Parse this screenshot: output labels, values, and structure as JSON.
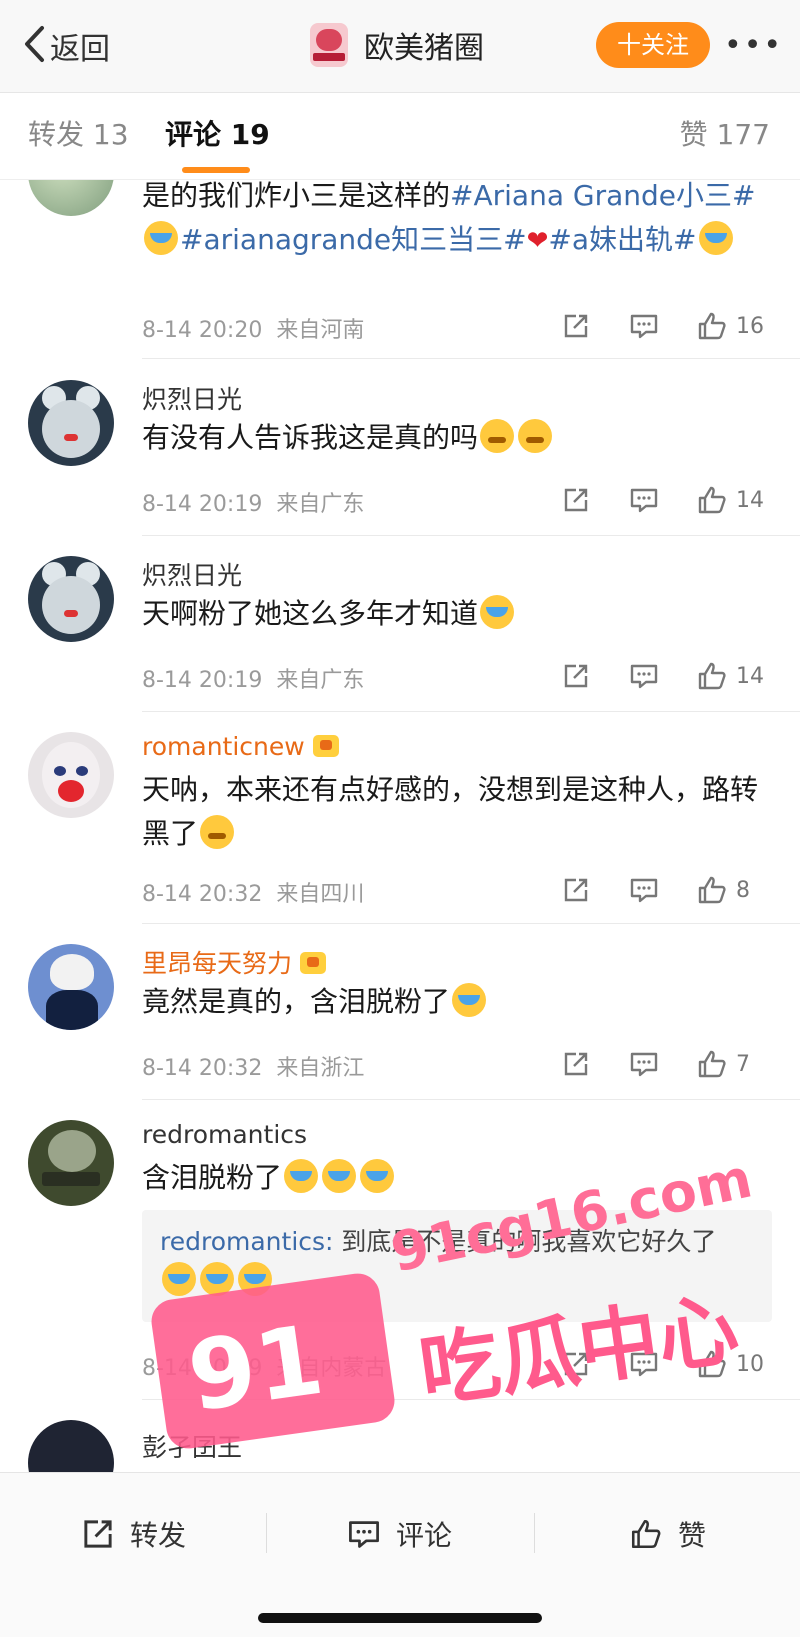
{
  "header": {
    "back_label": "返回",
    "title": "欧美猪圈",
    "follow_label": "十关注",
    "more_label": "•••"
  },
  "tabs": {
    "reposts": "转发 13",
    "comments": "评论 19",
    "likes": "赞 177"
  },
  "comments": [
    {
      "name": "",
      "text_parts": [
        "是的我们炸小三是这样的",
        "#Ariana Grande小三#",
        "#arianagrande知三当三#",
        "#a妹出轨#"
      ],
      "time": "8-14 20:20",
      "location": "来自河南",
      "likes": "16"
    },
    {
      "name": "炽烈日光",
      "text": "有没有人告诉我这是真的吗",
      "time": "8-14 20:19",
      "location": "来自广东",
      "likes": "14"
    },
    {
      "name": "炽烈日光",
      "text": "天啊粉了她这么多年才知道",
      "time": "8-14 20:19",
      "location": "来自广东",
      "likes": "14"
    },
    {
      "name": "romanticnew",
      "text": "天呐，本来还有点好感的，没想到是这种人，路转黑了",
      "time": "8-14 20:32",
      "location": "来自四川",
      "likes": "8"
    },
    {
      "name": "里昂每天努力",
      "text": "竟然是真的，含泪脱粉了",
      "time": "8-14 20:32",
      "location": "来自浙江",
      "likes": "7"
    },
    {
      "name": "redromantics",
      "text": "含泪脱粉了",
      "reply_name": "redromantics:",
      "reply_text": "到底是不是真的啊我喜欢它好久了",
      "time": "8-14 20:29",
      "location": "来自内蒙古",
      "likes": "10"
    },
    {
      "name": "彭孑囝王"
    }
  ],
  "watermark": {
    "url": "91cg16.com",
    "number": "91",
    "text": "吃瓜中心"
  },
  "bottom_bar": {
    "repost": "转发",
    "comment": "评论",
    "like": "赞"
  },
  "colors": {
    "accent_orange": "#ff8c1a",
    "hashtag_blue": "#3b6aa8",
    "vip_name": "#e86a17",
    "watermark_pink": "#ff5a8c"
  },
  "icons": {
    "repost": "share-icon",
    "comment": "comment-icon",
    "like": "thumbs-up-icon",
    "back": "chevron-left-icon"
  }
}
